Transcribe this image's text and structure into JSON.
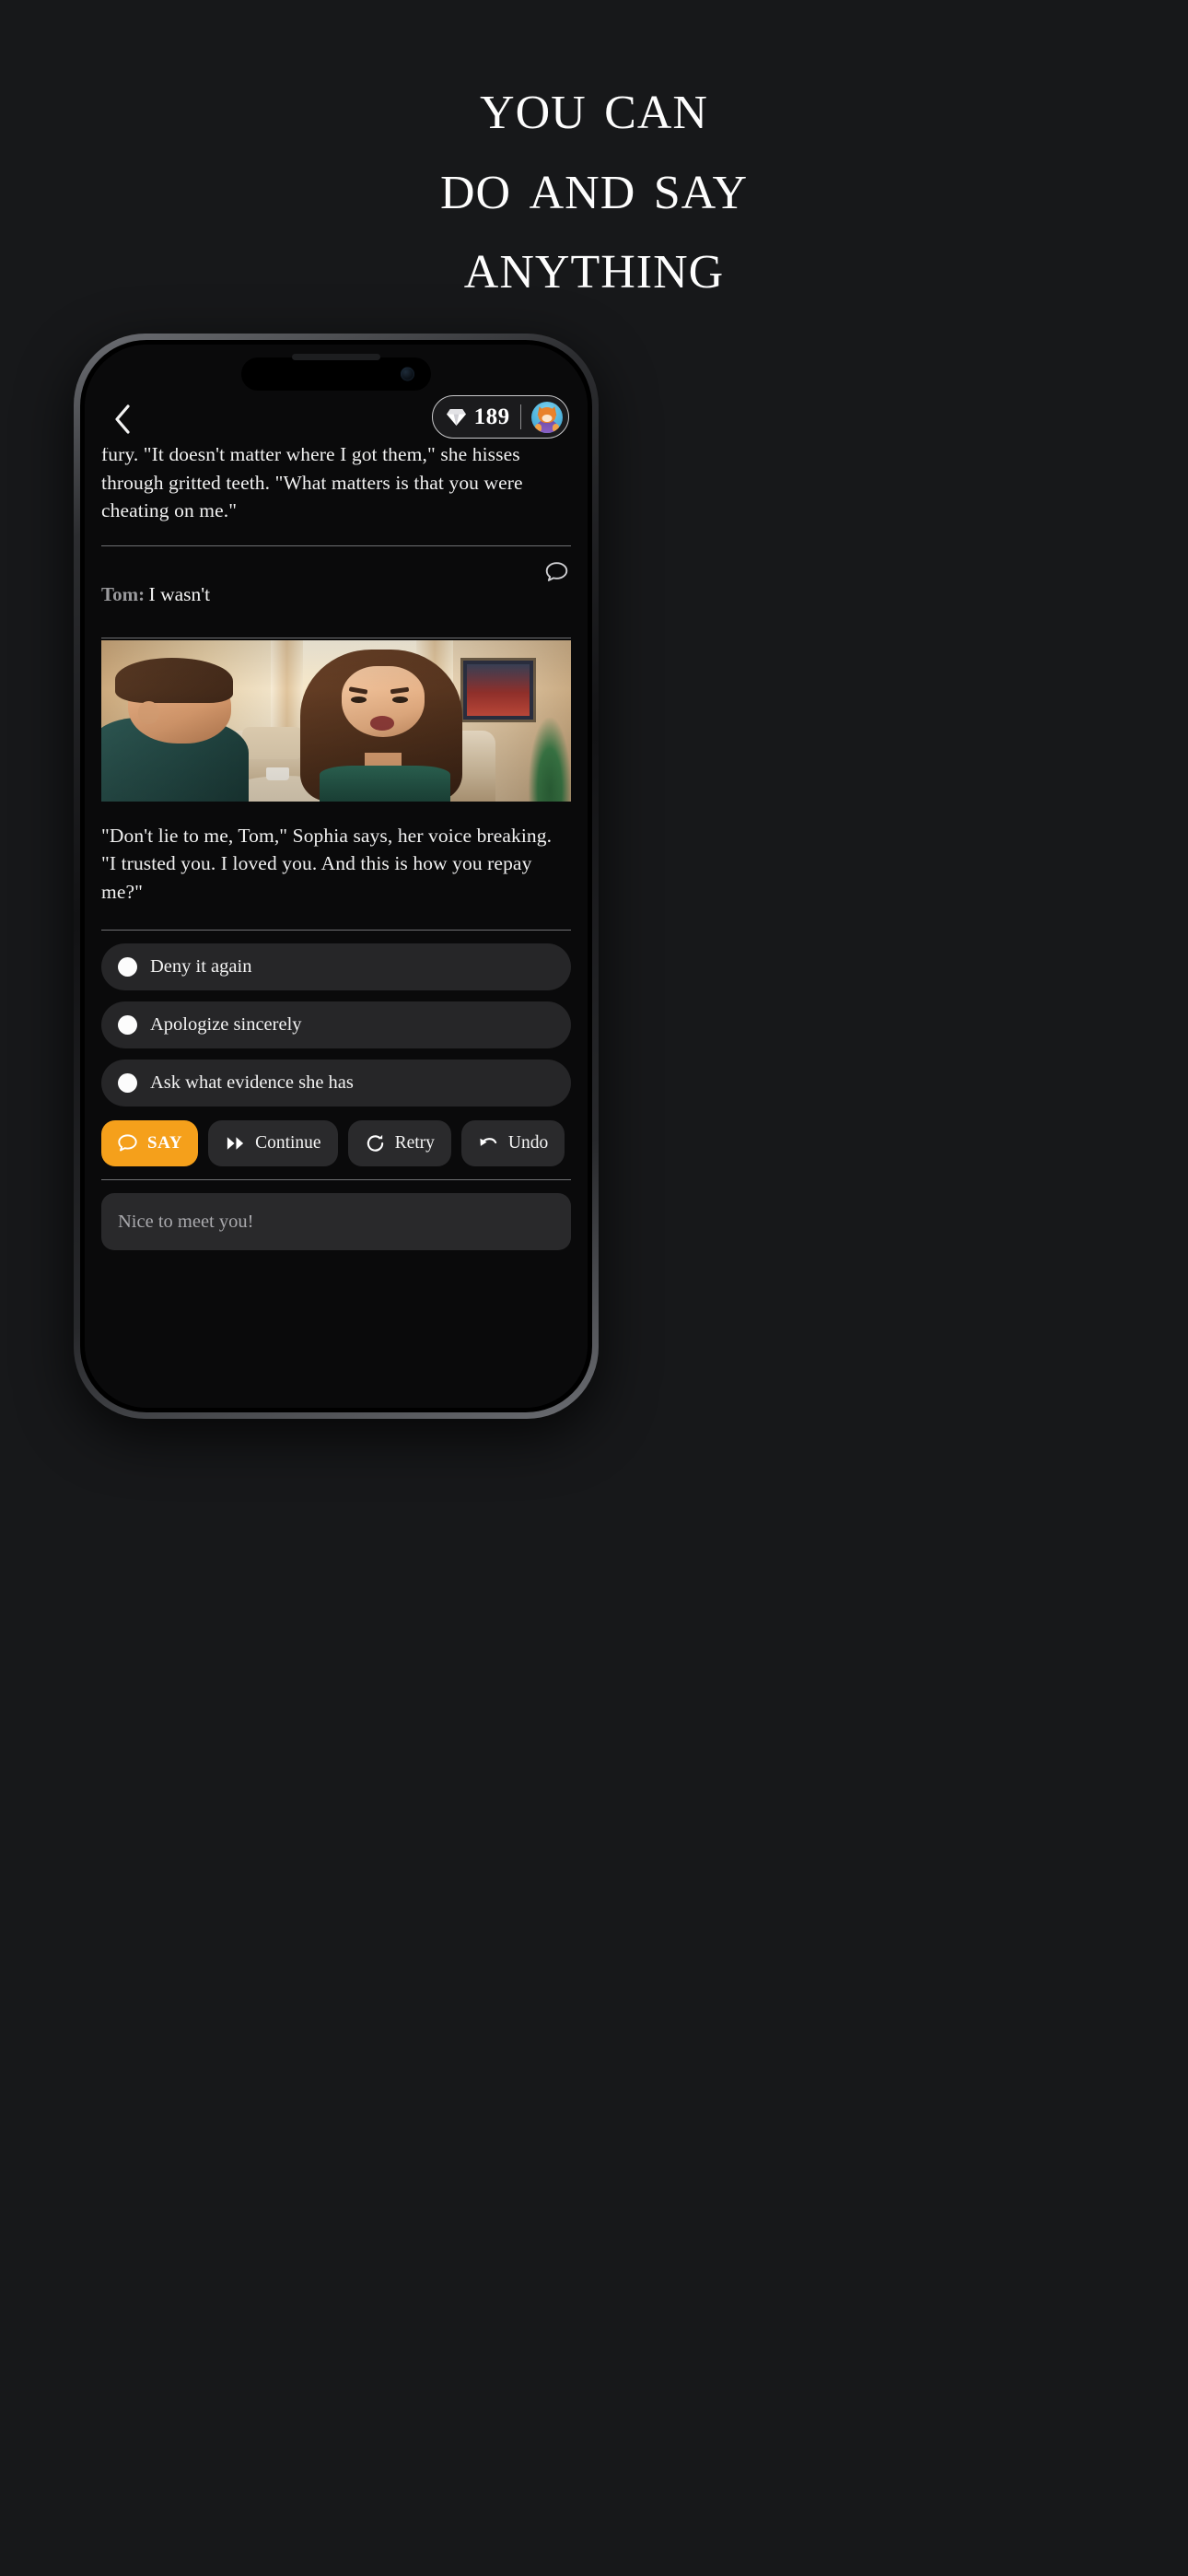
{
  "marketing": {
    "headline_lines": [
      "You can",
      "Do and Say",
      "Anything"
    ]
  },
  "phone": {
    "header": {
      "back_icon": "chevron-left-icon",
      "gem_icon": "diamond-icon",
      "gem_count": "189",
      "avatar_icon": "fox-avatar"
    },
    "story": {
      "clipped_paragraph": "fury. \"It doesn't matter where I got them,\" she hisses through gritted teeth. \"What matters is that you were cheating on me.\"",
      "turn": {
        "speaker": "Tom:",
        "text": "I wasn't",
        "bubble_icon": "speech-bubble-icon"
      },
      "illustration_alt": "Man and woman arguing in a living room",
      "paragraph_after": "\"Don't lie to me, Tom,\" Sophia says, her voice breaking. \"I trusted you. I loved you. And this is how you repay me?\""
    },
    "choices": [
      {
        "label": "Deny it again"
      },
      {
        "label": "Apologize sincerely"
      },
      {
        "label": "Ask what evidence she has"
      }
    ],
    "actions": [
      {
        "label": "SAY",
        "icon": "speech-bubble-icon",
        "primary": true
      },
      {
        "label": "Continue",
        "icon": "fast-forward-icon",
        "primary": false
      },
      {
        "label": "Retry",
        "icon": "refresh-icon",
        "primary": false
      },
      {
        "label": "Undo",
        "icon": "undo-arrow-icon",
        "primary": false
      }
    ],
    "composer": {
      "placeholder": "Nice to meet you!"
    }
  },
  "colors": {
    "page_background": "#17181a",
    "accent_orange": "#f5a01b",
    "screen_background": "#0a0a0b",
    "choice_background": "#262628"
  }
}
